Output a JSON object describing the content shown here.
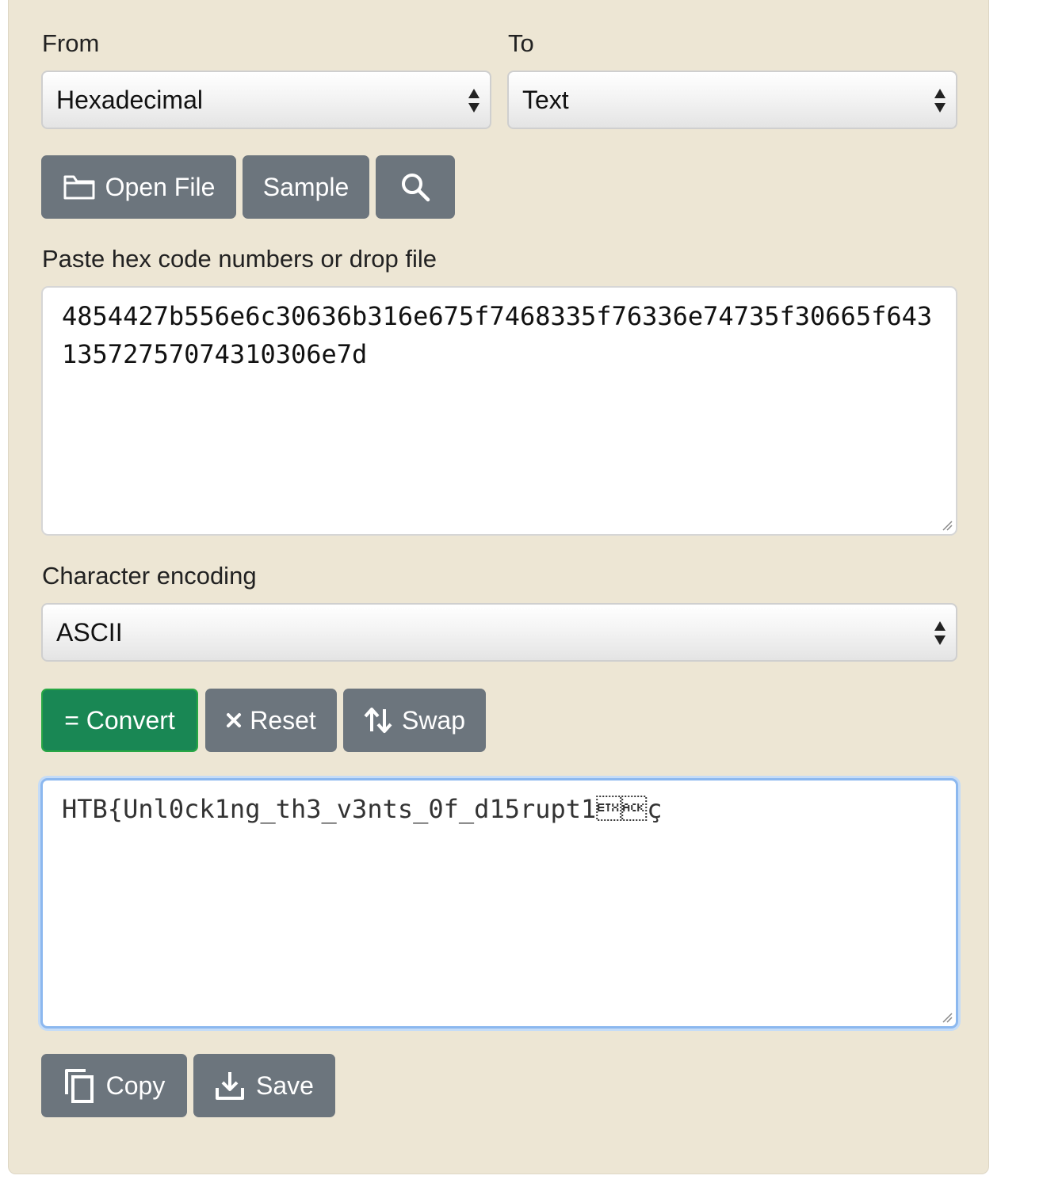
{
  "from": {
    "label": "From",
    "selected": "Hexadecimal"
  },
  "to": {
    "label": "To",
    "selected": "Text"
  },
  "file_buttons": {
    "open_file": "Open File",
    "sample": "Sample"
  },
  "input": {
    "label": "Paste hex code numbers or drop file",
    "value": "4854427b556e6c30636b316e675f7468335f76336e74735f30665f64313572757074310306e7d"
  },
  "encoding": {
    "label": "Character encoding",
    "selected": "ASCII"
  },
  "actions": {
    "convert": "= Convert",
    "reset": "Reset",
    "swap": "Swap"
  },
  "output": {
    "value": "HTB{Unl0ck1ng_th3_v3nts_0f_d15rupt1\u0003\u0006ç"
  },
  "output_buttons": {
    "copy": "Copy",
    "save": "Save"
  },
  "icons": {
    "open_file": "folder-icon",
    "search": "search-icon",
    "reset": "close-icon",
    "swap": "swap-arrows-icon",
    "copy": "copy-icon",
    "save": "download-icon"
  },
  "colors": {
    "panel_bg": "#ede6d4",
    "button_gray": "#6c757d",
    "button_green": "#198754",
    "focus_border": "#8cb8ef"
  }
}
